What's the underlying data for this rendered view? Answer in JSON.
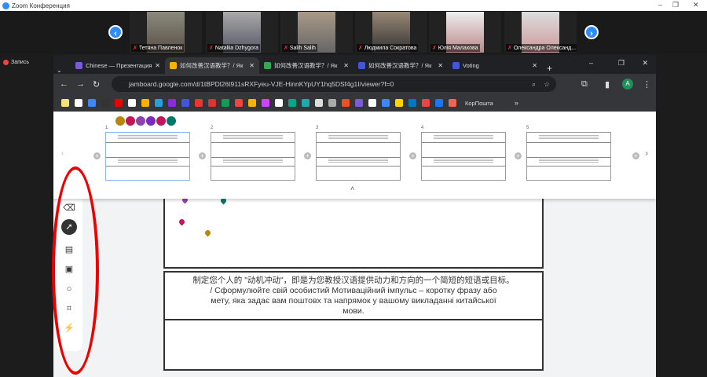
{
  "zoom": {
    "title": "Zoom Конференция",
    "record": "Запись",
    "participants": [
      "Тетяна Павленок",
      "Nataliia Dzhygora",
      "Salih Salih",
      "Людмила Сократова",
      "Юлія Малахова",
      "Олександра Олександ..."
    ]
  },
  "browser": {
    "tabs": [
      {
        "label": "Chinese — Презентация",
        "color": "#7b5cd6"
      },
      {
        "label": "如何改善汉语教学？/ Як",
        "color": "#f4b400",
        "active": true
      },
      {
        "label": "如何改善汉语教学？/ Як",
        "color": "#34a853"
      },
      {
        "label": "如何改善汉语教学？/ Як",
        "color": "#4355d8"
      },
      {
        "label": "Voting",
        "color": "#4355d8"
      }
    ],
    "url": "jamboard.google.com/d/1tBPDl26t911sRXFyeu-VJE-HinnKYpUY1hq5DSf4g1I/viewer?f=0",
    "profile": "A",
    "bookmark_last": "КорПошта",
    "bookmark_colors": [
      "#f4e27a",
      "#fff",
      "#4285f4",
      "#333",
      "#e00",
      "#fff",
      "#f4b400",
      "#2a9fd6",
      "#8a2be2",
      "#4355d8",
      "#e33",
      "#d33",
      "#0f9d58",
      "#e44",
      "#f4b400",
      "#c4f",
      "#fff",
      "#0a8",
      "#2aa",
      "#ddd",
      "#aaa",
      "#f24e1e",
      "#7b5cd6",
      "#fff",
      "#4285f4",
      "#ffd500",
      "#0079bf",
      "#e44",
      "#1877f2",
      "#e65"
    ]
  },
  "jamboard": {
    "frame_numbers": [
      "1",
      "2",
      "3",
      "4",
      "5"
    ],
    "avatar_colors": [
      "#b8860b",
      "#c2185b",
      "#8e44ad",
      "#7b2cbf",
      "#c2185b",
      "#00796b"
    ],
    "prompt_zh": "制定您个人的 \"动机冲动\"，即是为您教授汉语提供动力和方向的一个简短的短语或目标。",
    "prompt_uk": "/ Сформулюйте свій особистий Мотиваційний імпульс – коротку фразу або мету, яка задає вам поштовх та напрямок у вашому викладанні китайської мови."
  }
}
